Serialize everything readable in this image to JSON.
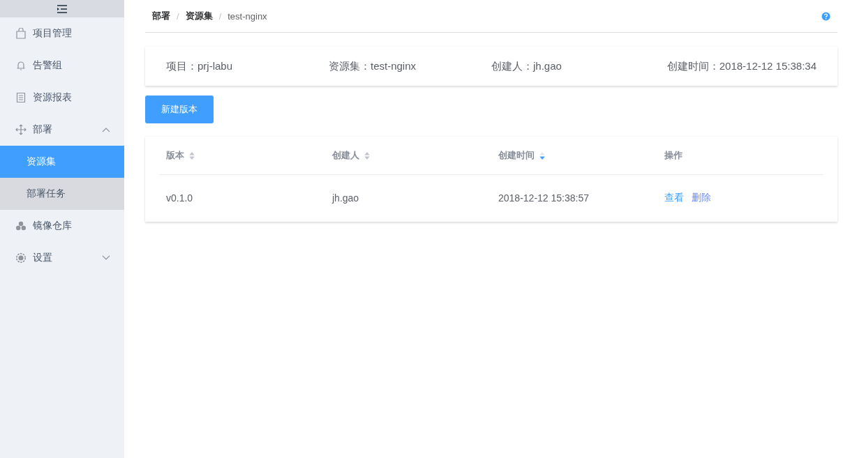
{
  "sidebar": {
    "items": [
      {
        "label": "项目管理",
        "selected": false
      },
      {
        "label": "告警组",
        "selected": false
      },
      {
        "label": "资源报表",
        "selected": false
      },
      {
        "label": "部署",
        "selected": false,
        "expanded": true,
        "children": [
          {
            "label": "资源集",
            "selected": true
          },
          {
            "label": "部署任务",
            "selected": false
          }
        ]
      },
      {
        "label": "镜像仓库",
        "selected": false
      },
      {
        "label": "设置",
        "selected": false,
        "expanded": false
      }
    ]
  },
  "breadcrumb": {
    "separator": "/",
    "items": [
      "部署",
      "资源集",
      "test-nginx"
    ]
  },
  "info": [
    {
      "label": "项目：",
      "value": "prj-labu"
    },
    {
      "label": "资源集：",
      "value": "test-nginx"
    },
    {
      "label": "创建人：",
      "value": "jh.gao"
    },
    {
      "label": "创建时间：",
      "value": "2018-12-12 15:38:34"
    }
  ],
  "new_button": "新建版本",
  "table": {
    "columns": [
      {
        "label": "版本",
        "sortable": true,
        "sorted": false
      },
      {
        "label": "创建人",
        "sortable": true,
        "sorted": false
      },
      {
        "label": "创建时间",
        "sortable": true,
        "sorted": true
      },
      {
        "label": "操作"
      }
    ],
    "rows": [
      {
        "cells": [
          "v0.1.0",
          "jh.gao",
          "2018-12-12 15:38:57"
        ],
        "actions": [
          "查看",
          "删除"
        ]
      }
    ]
  }
}
